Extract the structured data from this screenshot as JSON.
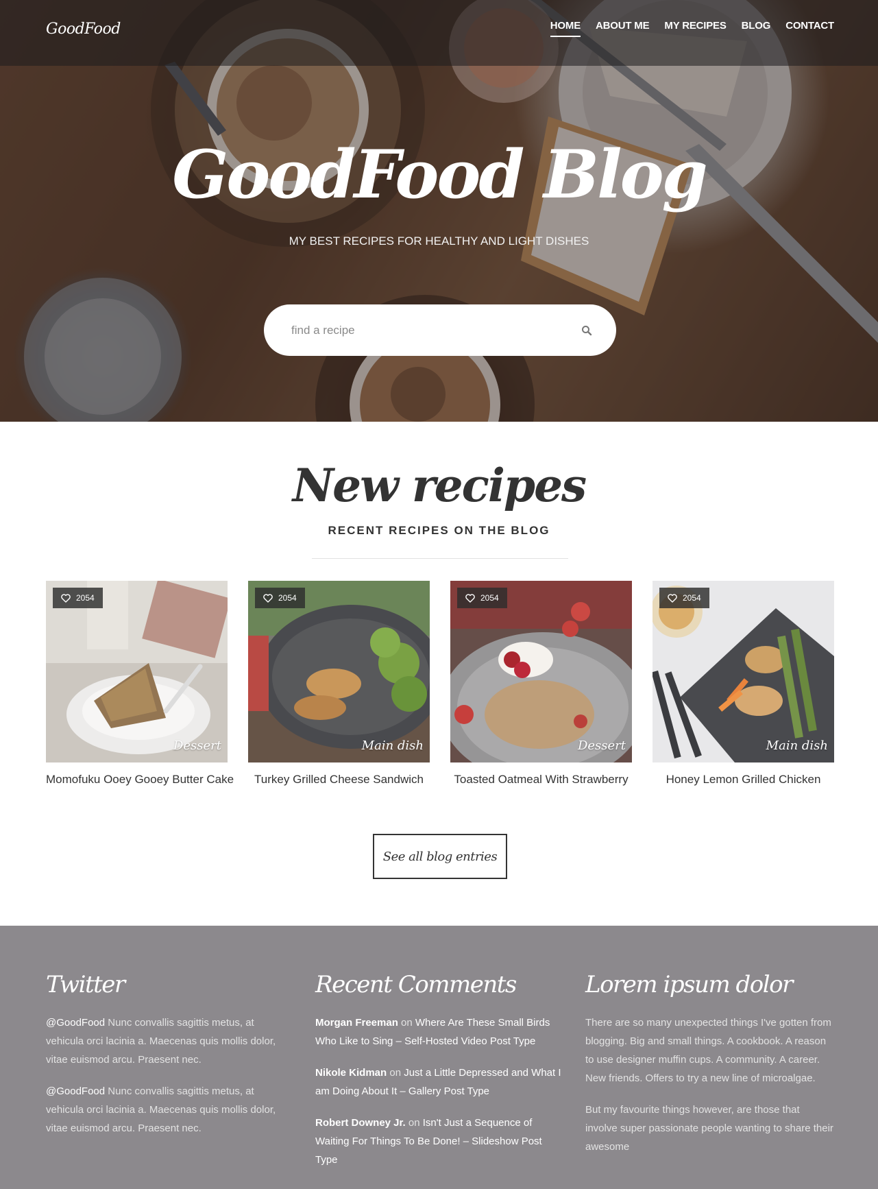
{
  "header": {
    "logo": "GoodFood",
    "nav": [
      {
        "label": "HOME",
        "active": true
      },
      {
        "label": "ABOUT ME",
        "active": false
      },
      {
        "label": "MY RECIPES",
        "active": false
      },
      {
        "label": "BLOG",
        "active": false
      },
      {
        "label": "CONTACT",
        "active": false
      }
    ]
  },
  "hero": {
    "title": "GoodFood Blog",
    "subtitle": "MY BEST RECIPES FOR HEALTHY AND LIGHT DISHES",
    "search_placeholder": "find a recipe",
    "search_icon": "search-icon"
  },
  "recipes": {
    "title": "New recipes",
    "subtitle": "RECENT RECIPES ON THE BLOG",
    "cards": [
      {
        "title": "Momofuku Ooey Gooey Butter Cake",
        "category": "Dessert",
        "likes": "2054"
      },
      {
        "title": "Turkey Grilled Cheese Sandwich",
        "category": "Main dish",
        "likes": "2054"
      },
      {
        "title": "Toasted Oatmeal With Strawberry",
        "category": "Dessert",
        "likes": "2054"
      },
      {
        "title": "Honey Lemon Grilled Chicken",
        "category": "Main dish",
        "likes": "2054"
      }
    ],
    "see_all_label": "See all blog entries"
  },
  "footer": {
    "twitter": {
      "title": "Twitter",
      "tweets": [
        {
          "handle": "@GoodFood",
          "text": "Nunc convallis sagittis metus, at vehicula orci lacinia a. Maecenas quis mollis dolor, vitae euismod arcu. Praesent nec."
        },
        {
          "handle": "@GoodFood",
          "text": "Nunc convallis sagittis metus, at vehicula orci lacinia a. Maecenas quis mollis dolor, vitae euismod arcu. Praesent nec."
        }
      ]
    },
    "comments": {
      "title": "Recent Comments",
      "connector": "on",
      "items": [
        {
          "author": "Morgan Freeman",
          "post": "Where Are These Small Birds Who Like to Sing – Self-Hosted Video Post Type"
        },
        {
          "author": "Nikole Kidman",
          "post": "Just a Little Depressed and What I am Doing About It – Gallery Post Type"
        },
        {
          "author": "Robert Downey Jr.",
          "post": "Isn't Just a Sequence of Waiting For Things To Be Done! – Slideshow Post Type"
        }
      ]
    },
    "about": {
      "title": "Lorem ipsum dolor",
      "paragraphs": [
        "There are so many unexpected things I've gotten from blogging. Big and small things. A cookbook. A reason to use designer muffin cups. A community. A career. New friends. Offers to try a new line of microalgae.",
        "But my favourite things however, are those that involve super passionate people wanting to share their awesome"
      ]
    }
  },
  "colors": {
    "footer_bg": "#8c898d",
    "text_dark": "#333333",
    "hero_overlay": "rgba(40,32,30,0.42)"
  }
}
